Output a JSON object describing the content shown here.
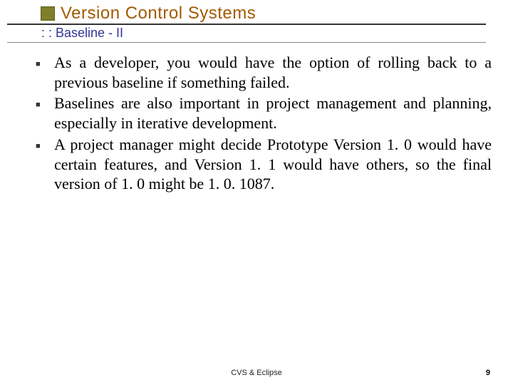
{
  "title": "Version Control Systems",
  "subtitle": ": : Baseline - II",
  "bullets": [
    "As a developer, you would have the option of rolling back to a previous baseline if something failed.",
    "Baselines are also important in project management and planning, especially in iterative development.",
    "A project manager might decide Prototype Version 1. 0 would have certain features, and Version 1. 1 would have others, so the final version of 1. 0 might be 1. 0. 1087."
  ],
  "footer_center": "CVS & Eclipse",
  "page_number": "9"
}
